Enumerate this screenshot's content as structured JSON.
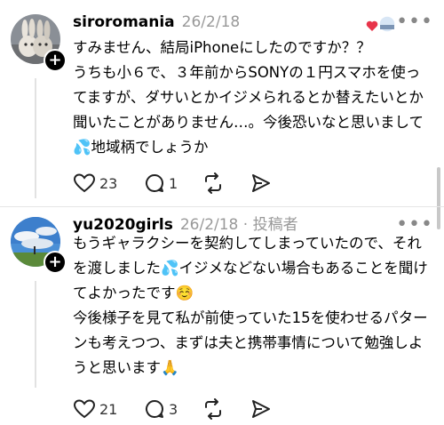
{
  "posts": [
    {
      "username": "siroromania",
      "date": "26/2/18",
      "author_badge": "",
      "body": "すみません、結局iPhoneにしたのですか？？\nうちも小６で、３年前からSONYの１円スマホを使ってますが、ダサいとかイジメられるとか替えたいとか聞いたことがありません…。今後恐いなと思いまして💦地域柄でしょうか",
      "likes": "23",
      "replies": "1",
      "more_icon": "more-horizontal-icon"
    },
    {
      "username": "yu2020girls",
      "date": "26/2/18",
      "separator": "·",
      "author_badge": "投稿者",
      "body": "もうギャラクシーを契約してしまっていたので、それを渡しました💦イジメなどない場合もあることを聞けてよかったです☺️\n今後様子を見て私が前使っていた15を使わせるパターンも考えつつ、まずは夫と携帯事情について勉強しようと思います🙏",
      "likes": "21",
      "replies": "3"
    }
  ],
  "colors": {
    "text": "#000000",
    "muted": "#999999",
    "divider": "#e6e6e6",
    "heart": "#e8344a"
  }
}
